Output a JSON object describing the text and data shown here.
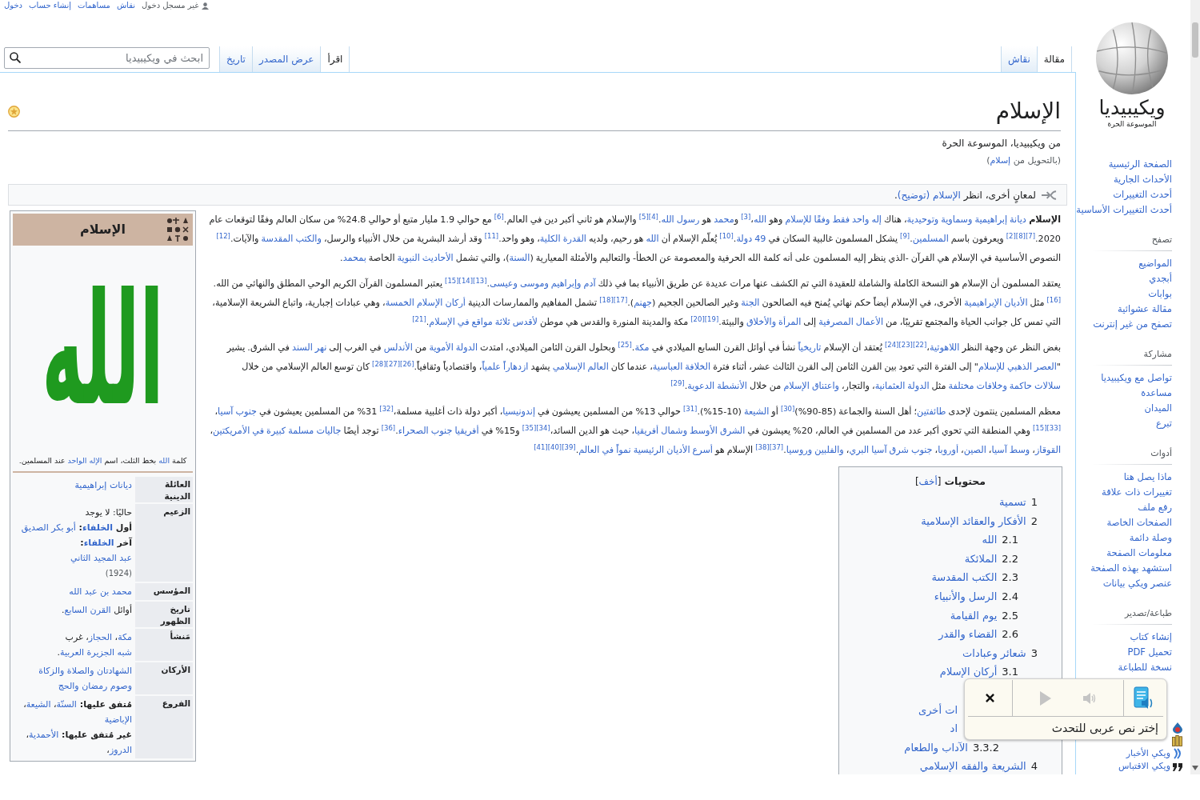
{
  "personal_bar": {
    "status": "غير مسجل دخول",
    "links": [
      "نقاش",
      "مساهمات",
      "إنشاء حساب",
      "دخول"
    ]
  },
  "tabs": {
    "page": [
      {
        "label": "مقالة",
        "selected": true
      },
      {
        "label": "نقاش",
        "selected": false
      }
    ],
    "views": [
      {
        "label": "اقرأ",
        "selected": true
      },
      {
        "label": "عرض المصدر",
        "selected": false
      },
      {
        "label": "تاريخ",
        "selected": false
      }
    ]
  },
  "search": {
    "placeholder": "ابحث في ويكيبيديا"
  },
  "sidebar": {
    "wordmark": "ويكيبيديا",
    "tagline": "الموسوعة الحرة",
    "main_links": [
      "الصفحة الرئيسية",
      "الأحداث الجارية",
      "أحدث التغييرات",
      "أحدث التغييرات الأساسية"
    ],
    "sections": [
      {
        "heading": "تصفح",
        "links": [
          "المواضيع",
          "أبجدي",
          "بوابات",
          "مقالة عشوائية",
          "تصفح من غير إنترنت"
        ]
      },
      {
        "heading": "مشاركة",
        "links": [
          "تواصل مع ويكيبيديا",
          "مساعدة",
          "الميدان",
          "تبرع"
        ]
      },
      {
        "heading": "أدوات",
        "links": [
          "ماذا يصل هنا",
          "تغييرات ذات علاقة",
          "رفع ملف",
          "الصفحات الخاصة",
          "وصلة دائمة",
          "معلومات الصفحة",
          "استشهد بهذه الصفحة",
          "عنصر ويكي بيانات"
        ]
      },
      {
        "heading": "طباعة/تصدير",
        "links": [
          "إنشاء كتاب",
          "تحميل PDF",
          "نسخة للطباعة"
        ]
      }
    ],
    "bottom_links": [
      {
        "kind": "covered"
      },
      {
        "kind": "covered"
      },
      {
        "kind": "link",
        "label": "ويكي الأخبار"
      },
      {
        "kind": "link",
        "label": "ويكي الاقتباس"
      }
    ]
  },
  "article": {
    "title": "الإسلام",
    "featured": true,
    "tagline": "من ويكيبيديا، الموسوعة الحرة",
    "redirect": [
      "(بالتحويل من ",
      {
        "kind": "link",
        "text": "إسلام"
      },
      ")"
    ],
    "hatnote": [
      "لمعانٍ أخرى، انظر ",
      {
        "kind": "link",
        "text": "الإسلام (توضيح)"
      },
      "."
    ],
    "paragraphs": [
      [
        {
          "kind": "bold",
          "text": "الإسلام "
        },
        {
          "kind": "link",
          "text": "ديانة إبراهيمية وسماوية وتوحيدية"
        },
        "، هناك ",
        {
          "kind": "link",
          "text": "إله واحد فقط وفقًا للإسلام"
        },
        " وهو ",
        {
          "kind": "link",
          "text": "الله"
        },
        "،",
        {
          "kind": "ref",
          "text": "[3]"
        },
        " و",
        {
          "kind": "link",
          "text": "محمد"
        },
        " هو ",
        {
          "kind": "link",
          "text": "رسول الله"
        },
        ".",
        {
          "kind": "ref",
          "text": "[4]"
        },
        {
          "kind": "ref",
          "text": "[5]"
        },
        " والإسلام هو ثاني أكبر دين في العالم.",
        {
          "kind": "ref",
          "text": "[6]"
        },
        " مع حوالي 1.9 مليار متبع أو حوالي 24.8% من سكان العالم وفقًا لتوقعات عام 2020.",
        {
          "kind": "ref",
          "text": "[7]"
        },
        {
          "kind": "ref",
          "text": "[8]"
        },
        {
          "kind": "ref",
          "text": "[2]"
        },
        " ويعرفون باسم ",
        {
          "kind": "link",
          "text": "المسلمين"
        },
        ".",
        {
          "kind": "ref",
          "text": "[9]"
        },
        " يشكل المسلمون غالبية السكان في ",
        {
          "kind": "link",
          "text": "49 دولة"
        },
        ".",
        {
          "kind": "ref",
          "text": "[10]"
        },
        " يُعلّم الإسلام أن ",
        {
          "kind": "link",
          "text": "الله"
        },
        " هو رحيم، ولديه ",
        {
          "kind": "link",
          "text": "القدرة الكلية"
        },
        "، وهو واحد.",
        {
          "kind": "ref",
          "text": "[11]"
        },
        " وقد أرشد البشرية من خلال الأنبياء والرسل، ",
        {
          "kind": "link",
          "text": "والكتب المقدسة"
        },
        " والآيات.",
        {
          "kind": "ref",
          "text": "[12]"
        },
        " النصوص الأساسية في الإسلام هي القرآن -الذي ينظر إليه المسلمون على أنه كلمة الله الحرفية والمعصومة عن الخطأ- والتعاليم والأمثلة المعيارية (",
        {
          "kind": "link",
          "text": "السنة"
        },
        ")، والتي تشمل ",
        {
          "kind": "link",
          "text": "الأحاديث النبوية"
        },
        " الخاصة ",
        {
          "kind": "link",
          "text": "بمحمد"
        },
        "."
      ],
      [
        "يعتقد المسلمون أن الإسلام هو النسخة الكاملة والشاملة للعقيدة التي تم الكشف عنها مرات عديدة عن طريق الأنبياء بما في ذلك ",
        {
          "kind": "link",
          "text": "آدم وإبراهيم وموسى وعيسى"
        },
        ".",
        {
          "kind": "ref",
          "text": "[13]"
        },
        {
          "kind": "ref",
          "text": "[14]"
        },
        {
          "kind": "ref",
          "text": "[15]"
        },
        " يعتبر المسلمون القرآن الكريم الوحي المطلق والنهائي من الله.",
        {
          "kind": "ref",
          "text": "[16]"
        },
        " مثل ",
        {
          "kind": "link",
          "text": "الأديان الإبراهيمية"
        },
        " الأخرى، في الإسلام أيضاً حكم نهائي يُمنح فيه الصالحون ",
        {
          "kind": "link",
          "text": "الجنة"
        },
        " وغير الصالحين الجحيم (",
        {
          "kind": "link",
          "text": "جهنم"
        },
        ").",
        {
          "kind": "ref",
          "text": "[17]"
        },
        {
          "kind": "ref",
          "text": "[18]"
        },
        " تشمل المفاهيم والممارسات الدينية ",
        {
          "kind": "link",
          "text": "أركان الإسلام الخمسة"
        },
        "، وهي عبادات إجبارية، واتباع الشريعة الإسلامية، التي تمس كل جوانب الحياة والمجتمع تقريبًا، من ",
        {
          "kind": "link",
          "text": "الأعمال المصرفية"
        },
        " إلى ",
        {
          "kind": "link",
          "text": "المرأة والأخلاق"
        },
        " والبيئة.",
        {
          "kind": "ref",
          "text": "[19]"
        },
        {
          "kind": "ref",
          "text": "[20]"
        },
        " مكة والمدينة المنورة والقدس هي موطن ",
        {
          "kind": "link",
          "text": "لأقدس ثلاثة مواقع في الإسلام"
        },
        ".",
        {
          "kind": "ref",
          "text": "[21]"
        }
      ],
      [
        "بغض النظر عن وجهة النظر ",
        {
          "kind": "link",
          "text": "اللاهوتية"
        },
        "،",
        {
          "kind": "ref",
          "text": "[22]"
        },
        {
          "kind": "ref",
          "text": "[23]"
        },
        {
          "kind": "ref",
          "text": "[24]"
        },
        " يُعتقد أن الإسلام ",
        {
          "kind": "link",
          "text": "تاريخياً"
        },
        " نشأ في أوائل القرن السابع الميلادي في ",
        {
          "kind": "link",
          "text": "مكة"
        },
        ".",
        {
          "kind": "ref",
          "text": "[25]"
        },
        " وبحلول القرن الثامن الميلادي، امتدت ",
        {
          "kind": "link",
          "text": "الدولة الأموية"
        },
        " من ",
        {
          "kind": "link",
          "text": "الأندلس"
        },
        " في الغرب إلى ",
        {
          "kind": "link",
          "text": "نهر السند"
        },
        " في الشرق. يشير \"",
        {
          "kind": "link",
          "text": "العصر الذهبي للإسلام"
        },
        "\" إلى الفترة التي تعود بين القرن الثامن إلى القرن الثالث عشر، أثناء فترة ",
        {
          "kind": "link",
          "text": "الخلافة العباسية"
        },
        "، عندما كان ",
        {
          "kind": "link",
          "text": "العالم الإسلامي"
        },
        " يشهد ",
        {
          "kind": "link",
          "text": "ازدهاراً علمياً"
        },
        "، واقتصادياً وثقافياً.",
        {
          "kind": "ref",
          "text": "[26]"
        },
        {
          "kind": "ref",
          "text": "[27]"
        },
        {
          "kind": "ref",
          "text": "[28]"
        },
        " كان توسع العالم الإسلامي من خلال ",
        {
          "kind": "link",
          "text": "سلالات حاكمة وخلافات مختلفة"
        },
        " مثل ",
        {
          "kind": "link",
          "text": "الدولة العثمانية"
        },
        "، والتجار، ",
        {
          "kind": "link",
          "text": "واعتناق الإسلام"
        },
        " من خلال ",
        {
          "kind": "link",
          "text": "الأنشطة الدعوية"
        },
        ".",
        {
          "kind": "ref",
          "text": "[29]"
        }
      ],
      [
        "معظم المسلمين ينتمون لإحدى ",
        {
          "kind": "link",
          "text": "طائفتين"
        },
        "؛ أهل السنة والجماعة (85-90%)",
        {
          "kind": "ref",
          "text": "[30]"
        },
        " أو ",
        {
          "kind": "link",
          "text": "الشيعة"
        },
        " (10-15%).",
        {
          "kind": "ref",
          "text": "[31]"
        },
        " حوالي 13% من المسلمين يعيشون في ",
        {
          "kind": "link",
          "text": "إندونيسيا"
        },
        "، أكبر دولة ذات أغلبية مسلمة،",
        {
          "kind": "ref",
          "text": "[32]"
        },
        " 31% من المسلمين يعيشون في ",
        {
          "kind": "link",
          "text": "جنوب آسيا"
        },
        "،",
        {
          "kind": "ref",
          "text": "[33]"
        },
        {
          "kind": "ref",
          "text": "[15]"
        },
        " وهي المنطقة التي تحوي أكبر عدد من المسلمين في العالم، 20% يعيشون في ",
        {
          "kind": "link",
          "text": "الشرق الأوسط وشمال أفريقيا"
        },
        "، حيث هو الدين السائد،",
        {
          "kind": "ref",
          "text": "[34]"
        },
        {
          "kind": "ref",
          "text": "[35]"
        },
        " و15% في ",
        {
          "kind": "link",
          "text": "أفريقيا جنوب الصحراء"
        },
        ".",
        {
          "kind": "ref",
          "text": "[36]"
        },
        " توجد أيضًا ",
        {
          "kind": "link",
          "text": "جاليات مسلمة كبيرة في الأمريكتين"
        },
        "، ",
        {
          "kind": "link",
          "text": "القوقاز"
        },
        "، ",
        {
          "kind": "link",
          "text": "وسط آسيا"
        },
        "، ",
        {
          "kind": "link",
          "text": "الصين"
        },
        "، ",
        {
          "kind": "link",
          "text": "أوروبا"
        },
        "، ",
        {
          "kind": "link",
          "text": "جنوب شرق آسيا البري"
        },
        "، ",
        {
          "kind": "link",
          "text": "والفلبين وروسيا"
        },
        ".",
        {
          "kind": "ref",
          "text": "[37]"
        },
        {
          "kind": "ref",
          "text": "[38]"
        },
        " الإسلام هو ",
        {
          "kind": "link",
          "text": "أسرع الأديان الرئيسية نمواً في العالم"
        },
        ".",
        {
          "kind": "ref",
          "text": "[39]"
        },
        {
          "kind": "ref",
          "text": "[40]"
        },
        {
          "kind": "ref",
          "text": "[41]"
        }
      ]
    ],
    "toc": {
      "title": "محتويات",
      "toggle": [
        "[",
        {
          "kind": "link",
          "text": "أخف"
        },
        "]"
      ],
      "items": [
        {
          "kind": "entry",
          "number": "1",
          "title": "تسمية"
        },
        {
          "kind": "entry",
          "number": "2",
          "title": "الأفكار والعقائد الإسلامية",
          "children": [
            {
              "kind": "entry",
              "number": "2.1",
              "title": "الله"
            },
            {
              "kind": "entry",
              "number": "2.2",
              "title": "الملائكة"
            },
            {
              "kind": "entry",
              "number": "2.3",
              "title": "الكتب المقدسة"
            },
            {
              "kind": "entry",
              "number": "2.4",
              "title": "الرسل والأنبياء"
            },
            {
              "kind": "entry",
              "number": "2.5",
              "title": "يوم القيامة"
            },
            {
              "kind": "entry",
              "number": "2.6",
              "title": "القضاء والقدر"
            }
          ]
        },
        {
          "kind": "entry",
          "number": "3",
          "title": "شعائر وعبادات",
          "children": [
            {
              "kind": "entry",
              "number": "3.1",
              "title": "أركان الإسلام"
            },
            {
              "kind": "covered"
            },
            {
              "kind": "covered",
              "title": "ات أخرى",
              "children": [
                {
                  "kind": "covered",
                  "title": "اد"
                },
                {
                  "kind": "entry",
                  "number": "3.3.2",
                  "title": "الآداب والطعام"
                }
              ]
            }
          ]
        },
        {
          "kind": "entry",
          "number": "4",
          "title": "الشريعة والفقه الإسلامي"
        }
      ]
    },
    "infobox": {
      "title": "الإسلام",
      "calligraphy": "الله",
      "caption": [
        "كلمة ",
        {
          "kind": "link",
          "text": "الله"
        },
        " بخط الثلث، اسم ",
        {
          "kind": "link",
          "text": "الإله الواحد"
        },
        " عند المسلمين."
      ],
      "rows": [
        {
          "label": "العائلة الدينية",
          "lines": [
            [
              {
                "kind": "link",
                "text": "ديانات إبراهيمية"
              }
            ]
          ]
        },
        {
          "label": "الزعيم",
          "lines": [
            [
              "حاليًا: لا يوجد"
            ],
            [
              {
                "kind": "bold",
                "text": "أول "
              },
              {
                "kind": "bold_link",
                "text": "الخلفاء"
              },
              {
                "kind": "bold",
                "text": ": "
              },
              {
                "kind": "link",
                "text": "أبو بكر الصديق"
              }
            ],
            [
              {
                "kind": "bold",
                "text": "آخر "
              },
              {
                "kind": "bold_link",
                "text": "الخلفاء"
              },
              {
                "kind": "bold",
                "text": ": "
              },
              {
                "kind": "link",
                "text": "عبد المجيد الثاني"
              }
            ],
            [
              {
                "kind": "small",
                "text": "(1924)"
              }
            ]
          ]
        },
        {
          "label": "المؤسس",
          "lines": [
            [
              {
                "kind": "link",
                "text": "محمد بن عبد الله"
              }
            ]
          ]
        },
        {
          "label": "تاريخ الظهور",
          "lines": [
            [
              "أوائل ",
              {
                "kind": "link",
                "text": "القرن السابع"
              },
              "."
            ]
          ]
        },
        {
          "label": "مَنشأ",
          "lines": [
            [
              {
                "kind": "link",
                "text": "مكة"
              },
              "، ",
              {
                "kind": "link",
                "text": "الحجاز"
              },
              "، غرب ",
              {
                "kind": "link",
                "text": "شبه الجزيرة العربية"
              },
              "."
            ]
          ]
        },
        {
          "label": "الأركان",
          "lines": [
            [
              {
                "kind": "link",
                "text": "الشهادتان والصلاة والزكاة وصوم رمضان والحج"
              }
            ]
          ]
        },
        {
          "label": "الفروع",
          "lines": [
            [
              {
                "kind": "bold",
                "text": "مُتفق عليها: "
              },
              {
                "kind": "link",
                "text": "السنّة"
              },
              "، ",
              {
                "kind": "link",
                "text": "الشيعة"
              },
              "، ",
              {
                "kind": "link",
                "text": "الإباضية"
              }
            ],
            [
              {
                "kind": "bold",
                "text": "غير مُتفق عليها: "
              },
              {
                "kind": "link",
                "text": "الأحمدية"
              },
              "، ",
              {
                "kind": "link",
                "text": "الدروز"
              },
              "،"
            ]
          ]
        }
      ]
    }
  },
  "tts_popup": {
    "prompt": "إختر نص عربى للتحدث",
    "player": {
      "disabled": true
    }
  }
}
